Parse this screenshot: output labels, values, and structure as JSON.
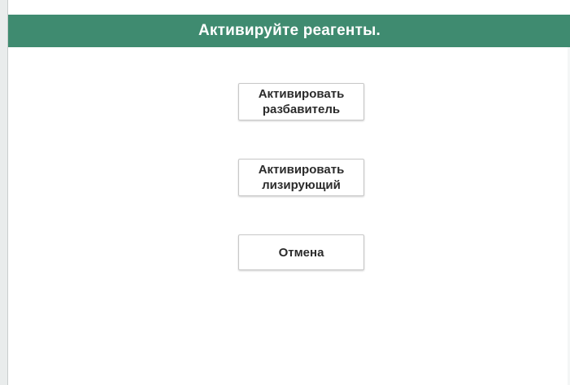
{
  "dialog": {
    "title": "Активируйте реагенты.",
    "buttons": [
      {
        "label": "Активировать\nразбавитель"
      },
      {
        "label": "Активировать\nлизирующий"
      },
      {
        "label": "Отмена"
      }
    ]
  },
  "colors": {
    "title_bar": "#3f8b70",
    "title_text": "#ffffff",
    "button_border": "#c8c8c8",
    "background": "#ffffff"
  }
}
